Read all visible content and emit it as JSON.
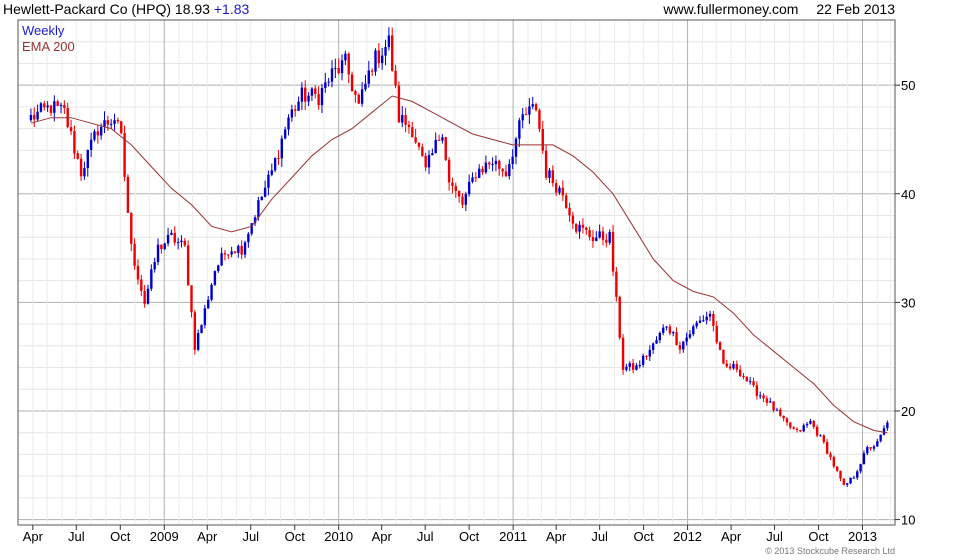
{
  "header": {
    "title": "Hewlett-Packard Co (HPQ) 18.93",
    "change": "+1.83",
    "change_color": "#1a1acc",
    "site": "www.fullermoney.com",
    "date": "22 Feb 2013"
  },
  "copyright": "© 2013 Stockcube Research Ltd",
  "colors": {
    "up": "#0000cc",
    "down": "#ee0000",
    "ema": "#993333",
    "grid": "#cccccc",
    "frame": "#555555"
  },
  "chart_data": {
    "type": "candlestick",
    "legend_location": "top-left",
    "grid": true,
    "series": [
      {
        "name": "Weekly",
        "color": "#1a1acc",
        "points": [
          [
            "2008-03-28",
            47
          ],
          [
            "2008-05-09",
            48
          ],
          [
            "2008-06-06",
            47.5
          ],
          [
            "2008-07-11",
            42
          ],
          [
            "2008-08-15",
            46
          ],
          [
            "2008-09-19",
            47
          ],
          [
            "2008-10-03",
            45
          ],
          [
            "2008-10-24",
            35
          ],
          [
            "2008-11-21",
            30
          ],
          [
            "2008-12-19",
            35
          ],
          [
            "2009-01-16",
            36
          ],
          [
            "2009-02-13",
            35
          ],
          [
            "2009-03-06",
            26
          ],
          [
            "2009-03-20",
            28
          ],
          [
            "2009-04-17",
            33
          ],
          [
            "2009-05-15",
            35
          ],
          [
            "2009-06-12",
            35
          ],
          [
            "2009-07-17",
            39
          ],
          [
            "2009-08-14",
            42
          ],
          [
            "2009-09-18",
            47
          ],
          [
            "2009-10-16",
            49
          ],
          [
            "2009-11-20",
            49
          ],
          [
            "2009-12-18",
            51
          ],
          [
            "2010-01-15",
            52
          ],
          [
            "2010-02-12",
            48
          ],
          [
            "2010-03-12",
            52
          ],
          [
            "2010-04-16",
            54
          ],
          [
            "2010-05-07",
            47
          ],
          [
            "2010-06-04",
            46
          ],
          [
            "2010-07-02",
            42
          ],
          [
            "2010-08-06",
            46
          ],
          [
            "2010-08-20",
            41
          ],
          [
            "2010-09-17",
            39
          ],
          [
            "2010-10-15",
            42
          ],
          [
            "2010-11-19",
            43
          ],
          [
            "2010-12-17",
            42
          ],
          [
            "2011-01-21",
            47
          ],
          [
            "2011-02-18",
            48
          ],
          [
            "2011-03-11",
            42
          ],
          [
            "2011-04-15",
            40
          ],
          [
            "2011-05-13",
            37
          ],
          [
            "2011-06-17",
            36
          ],
          [
            "2011-07-22",
            36
          ],
          [
            "2011-08-19",
            24
          ],
          [
            "2011-09-16",
            24
          ],
          [
            "2011-10-21",
            26
          ],
          [
            "2011-11-18",
            28
          ],
          [
            "2011-12-16",
            26
          ],
          [
            "2012-01-20",
            28
          ],
          [
            "2012-02-17",
            29
          ],
          [
            "2012-03-16",
            24
          ],
          [
            "2012-04-13",
            24
          ],
          [
            "2012-05-18",
            22
          ],
          [
            "2012-06-15",
            21
          ],
          [
            "2012-07-20",
            19
          ],
          [
            "2012-08-17",
            18
          ],
          [
            "2012-09-14",
            19
          ],
          [
            "2012-10-12",
            17
          ],
          [
            "2012-11-02",
            15
          ],
          [
            "2012-11-23",
            13
          ],
          [
            "2012-12-14",
            14
          ],
          [
            "2013-01-11",
            16.5
          ],
          [
            "2013-02-01",
            17
          ],
          [
            "2013-02-22",
            18.93
          ]
        ]
      },
      {
        "name": "EMA 200",
        "color": "#993333",
        "points": [
          [
            "2008-03-28",
            46.5
          ],
          [
            "2008-05-09",
            47
          ],
          [
            "2008-06-20",
            47
          ],
          [
            "2008-08-01",
            46.5
          ],
          [
            "2008-09-12",
            46
          ],
          [
            "2008-10-24",
            44.5
          ],
          [
            "2008-12-05",
            42.5
          ],
          [
            "2009-01-16",
            40.5
          ],
          [
            "2009-02-27",
            39
          ],
          [
            "2009-04-10",
            37
          ],
          [
            "2009-05-22",
            36.5
          ],
          [
            "2009-07-03",
            37
          ],
          [
            "2009-08-14",
            39.5
          ],
          [
            "2009-09-25",
            41.5
          ],
          [
            "2009-11-06",
            43.5
          ],
          [
            "2009-12-18",
            45
          ],
          [
            "2010-01-29",
            46
          ],
          [
            "2010-03-12",
            47.5
          ],
          [
            "2010-04-23",
            49
          ],
          [
            "2010-06-04",
            48.5
          ],
          [
            "2010-07-16",
            47.5
          ],
          [
            "2010-08-27",
            46.5
          ],
          [
            "2010-10-08",
            45.5
          ],
          [
            "2010-11-19",
            45
          ],
          [
            "2010-12-31",
            44.5
          ],
          [
            "2011-02-11",
            44.5
          ],
          [
            "2011-03-25",
            44.5
          ],
          [
            "2011-05-06",
            43.5
          ],
          [
            "2011-06-17",
            42
          ],
          [
            "2011-07-29",
            40
          ],
          [
            "2011-09-09",
            37
          ],
          [
            "2011-10-21",
            34
          ],
          [
            "2011-12-02",
            32
          ],
          [
            "2012-01-13",
            31
          ],
          [
            "2012-02-24",
            30.5
          ],
          [
            "2012-04-06",
            29
          ],
          [
            "2012-05-18",
            27
          ],
          [
            "2012-06-29",
            25.5
          ],
          [
            "2012-08-10",
            24
          ],
          [
            "2012-09-21",
            22.5
          ],
          [
            "2012-11-02",
            20.5
          ],
          [
            "2012-12-14",
            19
          ],
          [
            "2013-01-25",
            18.2
          ],
          [
            "2013-02-22",
            18
          ]
        ]
      }
    ],
    "x_ticks": [
      "Apr",
      "Jul",
      "Oct",
      "2009",
      "Apr",
      "Jul",
      "Oct",
      "2010",
      "Apr",
      "Jul",
      "Oct",
      "2011",
      "Apr",
      "Jul",
      "Oct",
      "2012",
      "Apr",
      "Jul",
      "Oct",
      "2013"
    ],
    "x_tick_dates": [
      "2008-04-01",
      "2008-07-01",
      "2008-10-01",
      "2009-01-01",
      "2009-04-01",
      "2009-07-01",
      "2009-10-01",
      "2010-01-01",
      "2010-04-01",
      "2010-07-01",
      "2010-10-01",
      "2011-01-01",
      "2011-04-01",
      "2011-07-01",
      "2011-10-01",
      "2012-01-01",
      "2012-04-01",
      "2012-07-01",
      "2012-10-01",
      "2013-01-01"
    ],
    "x_range": [
      "2008-03-01",
      "2013-03-10"
    ],
    "y_ticks": [
      10,
      20,
      30,
      40,
      50
    ],
    "y_range": [
      9.5,
      56
    ],
    "y_axis_position": "right"
  }
}
